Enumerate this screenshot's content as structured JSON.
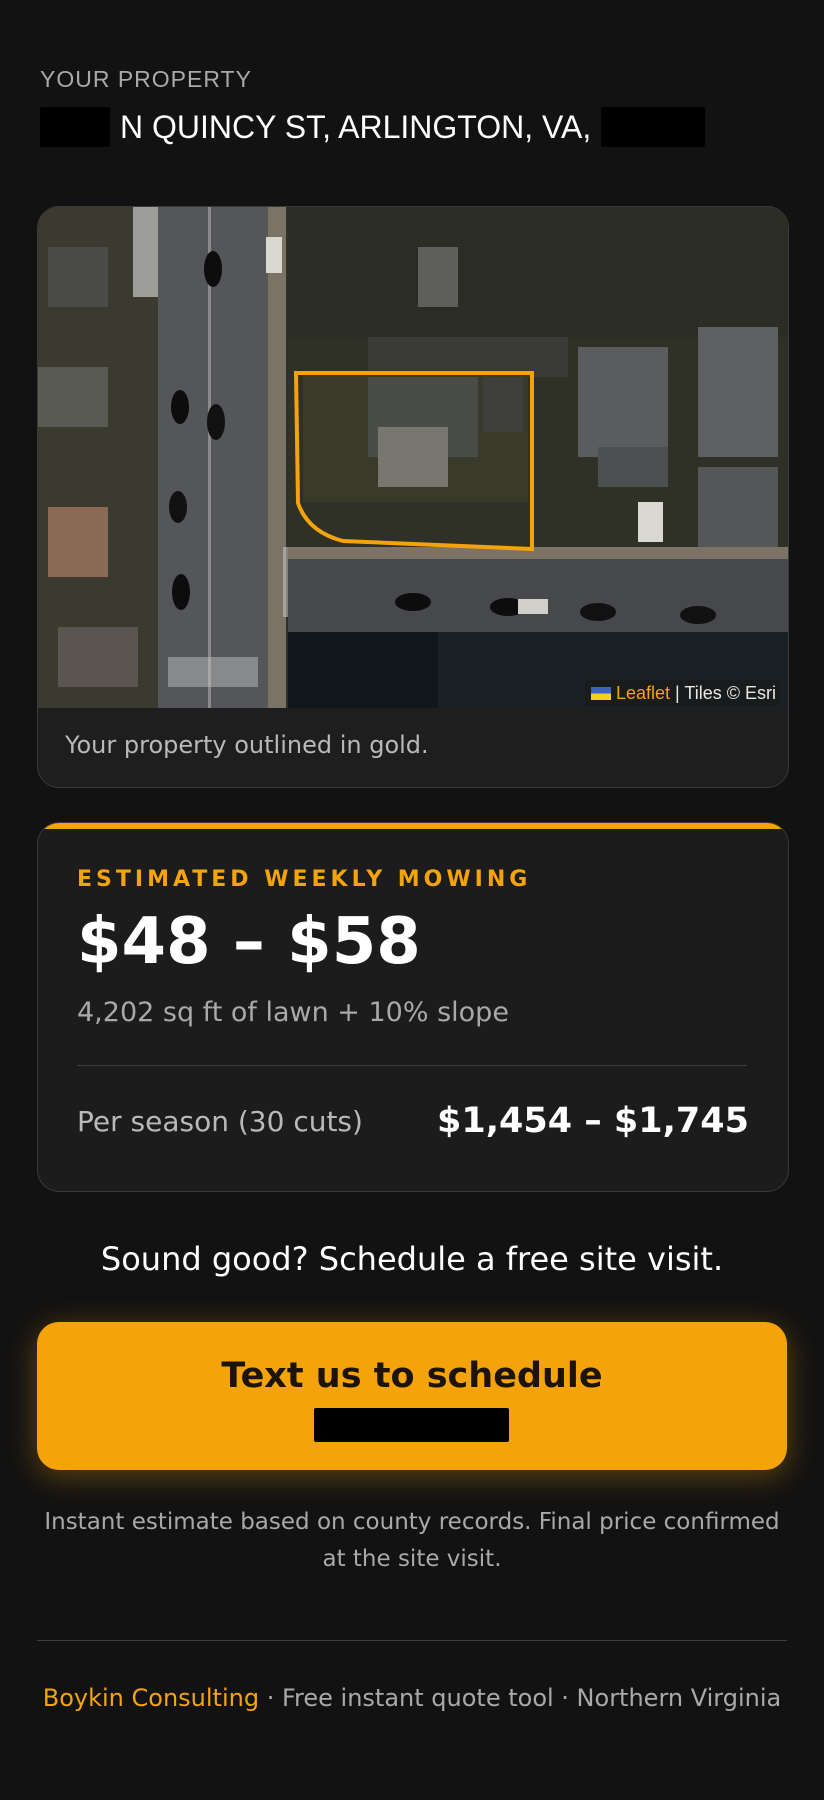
{
  "property": {
    "eyebrow": "YOUR PROPERTY",
    "address_street": "N QUINCY ST, ARLINGTON, VA,"
  },
  "map": {
    "attribution_link": "Leaflet",
    "attribution_text": "| Tiles © Esri",
    "caption": "Your property outlined in gold."
  },
  "estimate": {
    "label": "ESTIMATED WEEKLY MOWING",
    "range": "$48 – $58",
    "detail": "4,202 sq ft of lawn + 10% slope",
    "season_label": "Per season (30 cuts)",
    "season_value": "$1,454 – $1,745"
  },
  "cta": {
    "prompt": "Sound good? Schedule a free site visit.",
    "button_label": "Text us to schedule"
  },
  "disclaimer": "Instant estimate based on county records. Final price confirmed at the site visit.",
  "footer": {
    "brand": "Boykin Consulting",
    "rest": " · Free instant quote tool · Northern Virginia"
  },
  "colors": {
    "accent": "#f5a30a",
    "background": "#121212",
    "card": "#1c1c1c"
  }
}
